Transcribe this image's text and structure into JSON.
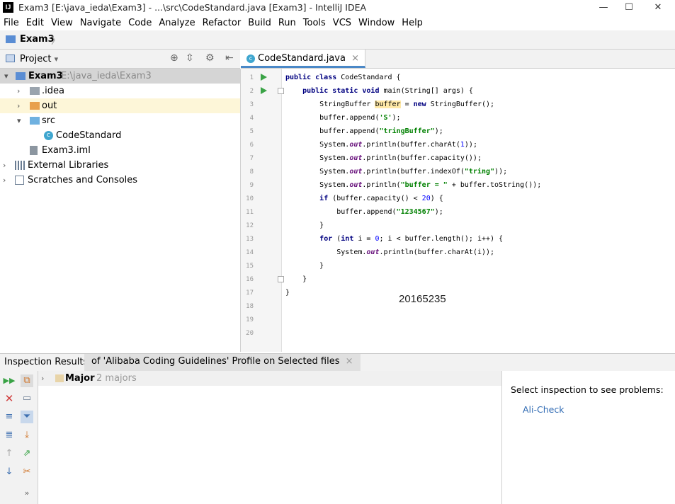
{
  "window": {
    "title": "Exam3 [E:\\java_ieda\\Exam3] - ...\\src\\CodeStandard.java [Exam3] - IntelliJ IDEA",
    "logo": "IJ",
    "minimize": "—",
    "maximize": "☐",
    "close": "✕"
  },
  "menu": [
    "File",
    "Edit",
    "View",
    "Navigate",
    "Code",
    "Analyze",
    "Refactor",
    "Build",
    "Run",
    "Tools",
    "VCS",
    "Window",
    "Help"
  ],
  "nav": {
    "project": "Exam3",
    "separator": "〉"
  },
  "project_panel": {
    "title": "Project",
    "dropdown": "▾",
    "tree": [
      {
        "arrow": "▾",
        "label": "Exam3",
        "suffix": "E:\\java_ieda\\Exam3",
        "icon": "module-folder-icon"
      },
      {
        "arrow": "›",
        "label": ".idea",
        "icon": "folder-icon"
      },
      {
        "arrow": "›",
        "label": "out",
        "icon": "folder-orange-icon"
      },
      {
        "arrow": "▾",
        "label": "src",
        "icon": "source-folder-icon"
      },
      {
        "arrow": "",
        "label": "CodeStandard",
        "icon": "java-class-icon"
      },
      {
        "arrow": "",
        "label": "Exam3.iml",
        "icon": "iml-file-icon"
      },
      {
        "arrow": "›",
        "label": "External Libraries",
        "icon": "libraries-icon"
      },
      {
        "arrow": "›",
        "label": "Scratches and Consoles",
        "icon": "scratches-icon"
      }
    ]
  },
  "editor": {
    "tab_label": "CodeStandard.java",
    "tab_close": "×",
    "line_numbers": [
      "1",
      "2",
      "3",
      "4",
      "5",
      "6",
      "7",
      "8",
      "9",
      "10",
      "11",
      "12",
      "13",
      "14",
      "15",
      "16",
      "17",
      "18",
      "19",
      "20"
    ],
    "watermark": "20165235",
    "code": {
      "l1a": "public class",
      "l1b": " CodeStandard {",
      "l2a": "public static void",
      "l2b": " main(String[] args) {",
      "l3a": "StringBuffer ",
      "l3b": "buffer",
      "l3c": " = ",
      "l3d": "new",
      "l3e": " StringBuffer();",
      "l4a": "buffer.append(",
      "l4b": "'S'",
      "l4c": ");",
      "l5a": "buffer.append(",
      "l5b": "\"tringBuffer\"",
      "l5c": ");",
      "l6a": "System.",
      "l6b": "out",
      "l6c": ".println(buffer.charAt(",
      "l6d": "1",
      "l6e": "));",
      "l7a": "System.",
      "l7b": "out",
      "l7c": ".println(buffer.capacity());",
      "l8a": "System.",
      "l8b": "out",
      "l8c": ".println(buffer.indexOf(",
      "l8d": "\"tring\"",
      "l8e": "));",
      "l9a": "System.",
      "l9b": "out",
      "l9c": ".println(",
      "l9d": "\"buffer = \"",
      "l9e": " + buffer.toString());",
      "l10a": "if",
      "l10b": " (buffer.capacity() < ",
      "l10c": "20",
      "l10d": ") {",
      "l11a": "buffer.append(",
      "l11b": "\"1234567\"",
      "l11c": ");",
      "l12": "}",
      "l13a": "for",
      "l13b": " (",
      "l13c": "int",
      "l13d": " i = ",
      "l13e": "0",
      "l13f": "; i < buffer.length(); i++) {",
      "l14a": "System.",
      "l14b": "out",
      "l14c": ".println(buffer.charAt(i));",
      "l15": "}",
      "l16": "}",
      "l17": "}"
    }
  },
  "inspection": {
    "label": "Inspection Results:",
    "tab": "of 'Alibaba Coding Guidelines' Profile on Selected files",
    "tab_close": "×",
    "group_label": "Major",
    "group_count": "2 majors",
    "hint": "Select inspection to see problems:",
    "link": "Ali-Check",
    "more": "»"
  }
}
